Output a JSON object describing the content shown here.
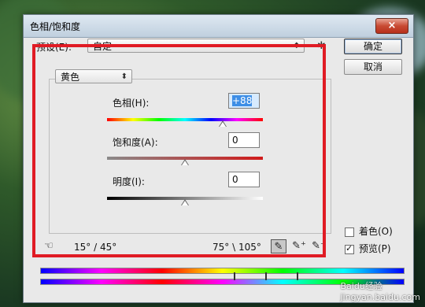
{
  "window": {
    "title": "色相/饱和度",
    "close_icon": "×"
  },
  "preset": {
    "label": "预设(E):",
    "value": "自定"
  },
  "buttons": {
    "ok": "确定",
    "cancel": "取消"
  },
  "channel": {
    "value": "黄色"
  },
  "hue": {
    "label": "色相(H):",
    "value": "+88",
    "level": 0.74
  },
  "saturation": {
    "label": "饱和度(A):",
    "value": "0",
    "level": 0.5
  },
  "lightness": {
    "label": "明度(I):",
    "value": "0",
    "level": 0.5
  },
  "range": {
    "left": "15° / 45°",
    "right": "75° \\ 105°"
  },
  "options": {
    "colorize": {
      "label": "着色(O)",
      "checked": false
    },
    "preview": {
      "label": "预览(P)",
      "checked": true
    }
  },
  "watermark": {
    "brand": "Baidu经验",
    "url": "jingyan.baidu.com"
  },
  "colors": {
    "highlight": "#e01b24",
    "selection": "#3d8ee6"
  }
}
